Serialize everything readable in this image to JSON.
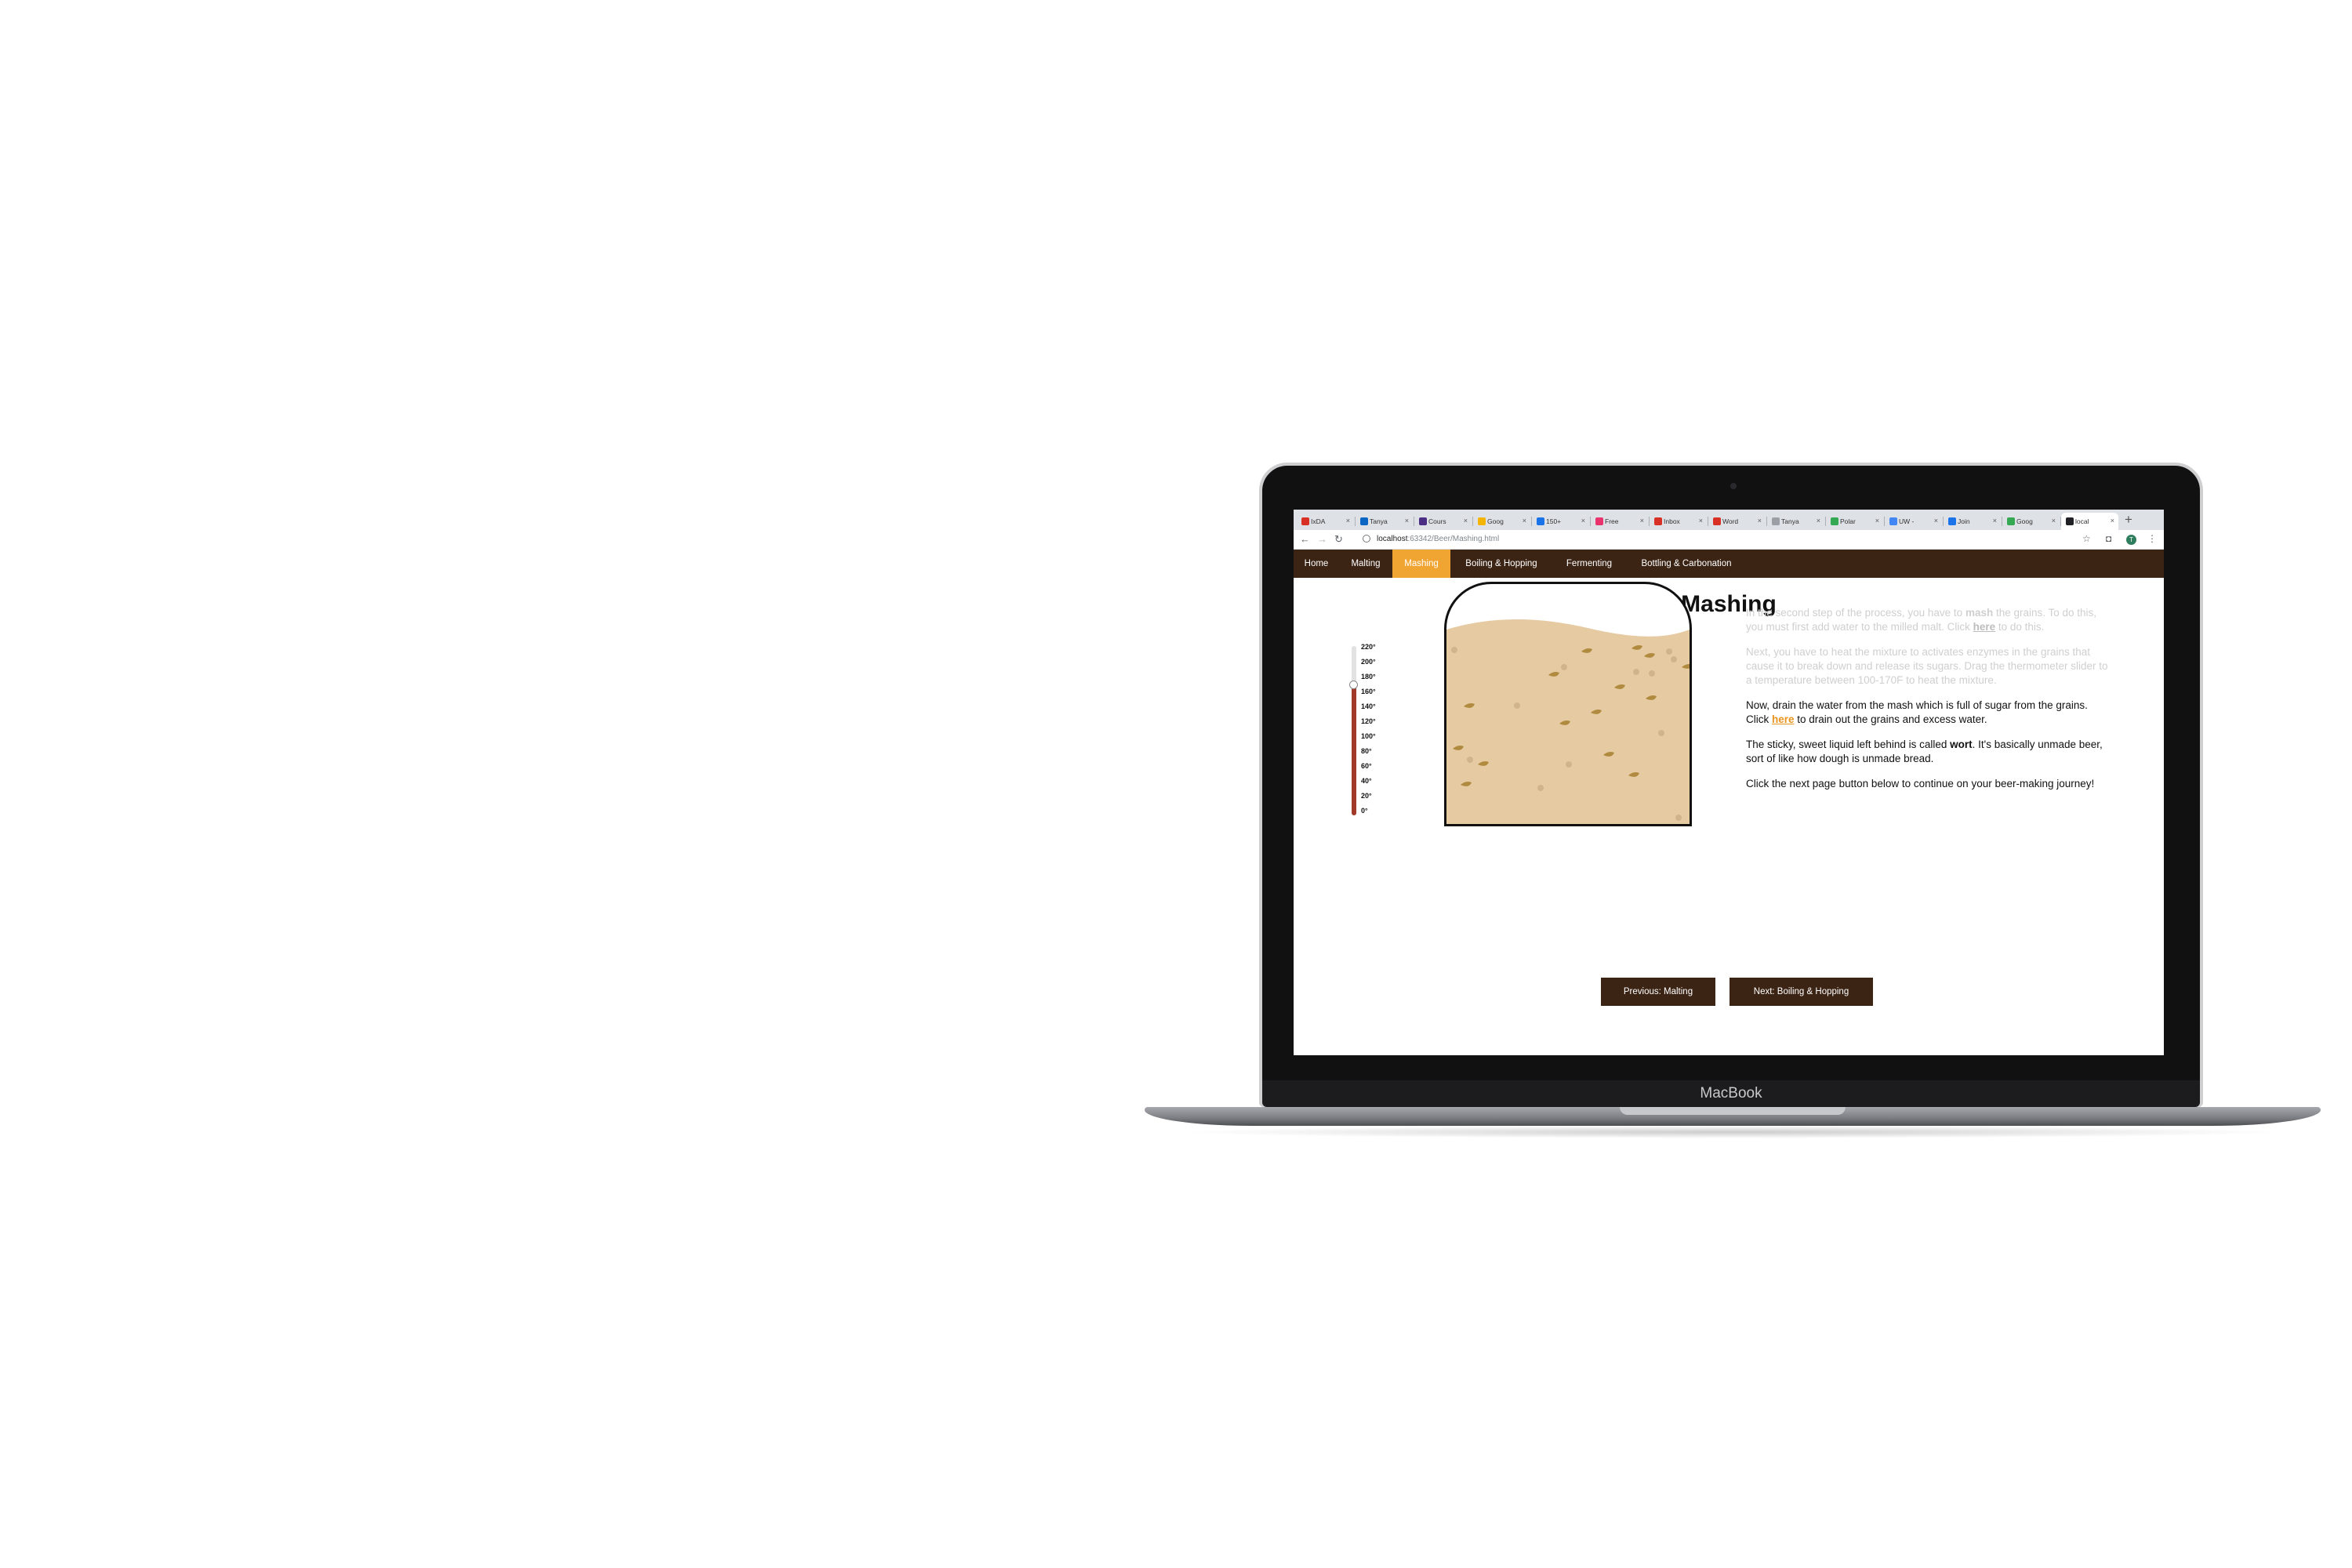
{
  "browser": {
    "tabs": [
      {
        "label": "IxDA",
        "favicon_color": "#d93025"
      },
      {
        "label": "Tanya",
        "favicon_color": "#0a66c2"
      },
      {
        "label": "Cours",
        "favicon_color": "#4b2e83"
      },
      {
        "label": "Goog",
        "favicon_color": "#f4b400"
      },
      {
        "label": "150+",
        "favicon_color": "#1a73e8"
      },
      {
        "label": "Free",
        "favicon_color": "#e8336d"
      },
      {
        "label": "Inbox",
        "favicon_color": "#d93025"
      },
      {
        "label": "Word",
        "favicon_color": "#d93025"
      },
      {
        "label": "Tanya",
        "favicon_color": "#9aa0a6"
      },
      {
        "label": "Polar",
        "favicon_color": "#34a853"
      },
      {
        "label": "UW -",
        "favicon_color": "#4285f4"
      },
      {
        "label": "Join",
        "favicon_color": "#1a73e8"
      },
      {
        "label": "Goog",
        "favicon_color": "#34a853"
      },
      {
        "label": "local",
        "favicon_color": "#202124"
      }
    ],
    "active_tab_index": 13,
    "url_host": "localhost",
    "url_path": ":63342/Beer/Mashing.html",
    "profile_initial": "T"
  },
  "nav": {
    "items": [
      {
        "label": "Home",
        "active": false
      },
      {
        "label": "Malting",
        "active": false
      },
      {
        "label": "Mashing",
        "active": true
      },
      {
        "label": "Boiling & Hopping",
        "active": false
      },
      {
        "label": "Fermenting",
        "active": false
      },
      {
        "label": "Bottling & Carbonation",
        "active": false
      }
    ],
    "active_color": "#f0a533",
    "bar_color": "#3c2415"
  },
  "page": {
    "title": "Mashing"
  },
  "thermometer": {
    "ticks": [
      "220°",
      "200°",
      "180°",
      "160°",
      "140°",
      "120°",
      "100°",
      "80°",
      "60°",
      "40°",
      "20°",
      "0°"
    ],
    "value": 160,
    "fill_color": "#a23a2a"
  },
  "mash_tun": {
    "mash_color": "#e6caa2",
    "grain_color": "#b08a3e"
  },
  "steps": {
    "p1": {
      "a": "In the second step of the process, you have to ",
      "b": "mash",
      "c": " the grains. To do this, you must first add water to the milled malt. Click ",
      "link": "here",
      "d": " to do this."
    },
    "p2": {
      "text": "Next, you have to heat the mixture to activates enzymes in the grains that cause it to break down and release its sugars. Drag the thermometer slider to a temperature between 100-170F to heat the mixture."
    },
    "p3": {
      "a": "Now, drain the water from the mash which is full of sugar from the grains. Click ",
      "link": "here",
      "b": " to drain out the grains and excess water."
    },
    "p4": {
      "a": "The sticky, sweet liquid left behind is called ",
      "b": "wort",
      "c": ". It's basically unmade beer, sort of like how dough is unmade bread."
    },
    "p5": {
      "text": "Click the next page button below to continue on your beer-making journey!"
    }
  },
  "buttons": {
    "prev": "Previous: Malting",
    "next": "Next: Boiling & Hopping"
  },
  "device": {
    "brand": "MacBook"
  }
}
